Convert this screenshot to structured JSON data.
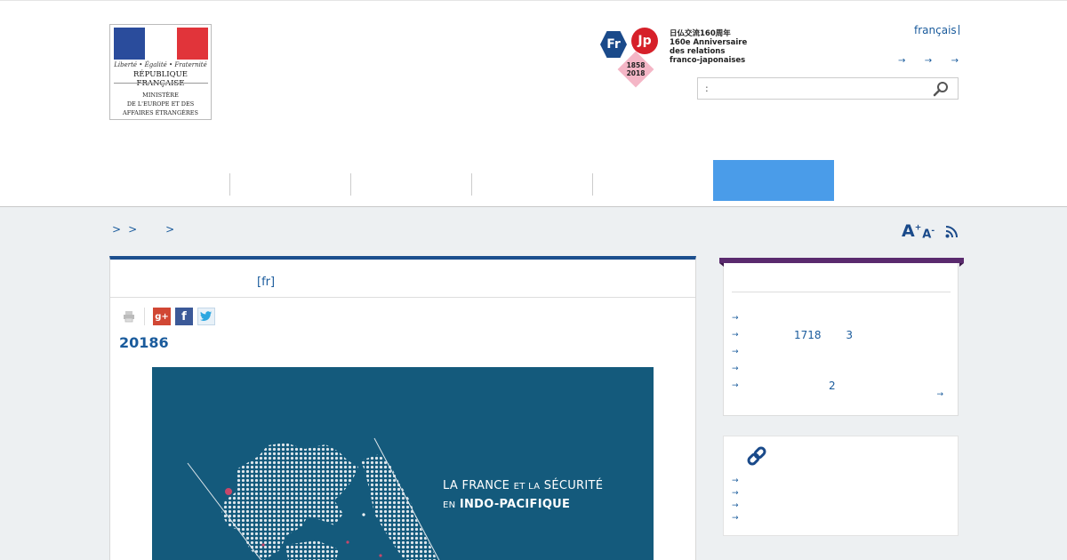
{
  "logo": {
    "motto": "Liberté • Égalité • Fraternité",
    "republic": "RÉPUBLIQUE FRANÇAISE",
    "ministry_line1": "MINISTÈRE",
    "ministry_line2": "DE L'EUROPE ET DES",
    "ministry_line3": "AFFAIRES ÉTRANGÈRES"
  },
  "anniversary": {
    "fr": "Fr",
    "jp": "Jp",
    "year_start": "1858",
    "year_end": "2018",
    "line1": "日仏交流160周年",
    "line2": "160e Anniversaire",
    "line3": "des relations",
    "line4": "franco-japonaises"
  },
  "header": {
    "language": "français",
    "top_links": [
      "→",
      "→",
      "→"
    ]
  },
  "search": {
    "value": ":",
    "placeholder": ""
  },
  "breadcrumb": {
    "sep1": ">",
    "sep2": ">",
    "sep3": ">"
  },
  "tools": {
    "font_increase": "A",
    "font_increase_sup": "+",
    "font_decrease": "A",
    "font_decrease_sup": "-"
  },
  "article": {
    "lang_link": "[fr]",
    "title": "20186",
    "image_caption_line1_a": "LA FRANCE",
    "image_caption_line1_b": "ET LA",
    "image_caption_line1_c": "SÉCURITÉ",
    "image_caption_line2_a": "EN",
    "image_caption_line2_b": "INDO-PACIFIQUE"
  },
  "sidebar": {
    "news_items": [
      "",
      "1718 3",
      "",
      "",
      "2"
    ],
    "more_arrow": "→",
    "links_items": [
      "",
      "",
      "",
      ""
    ]
  },
  "colors": {
    "accent_blue": "#4a9ce9",
    "link_blue": "#1a5b9c",
    "article_border": "#1c4f8e",
    "sidebar_purple": "#5a2a6e",
    "image_background": "#145a7c"
  }
}
